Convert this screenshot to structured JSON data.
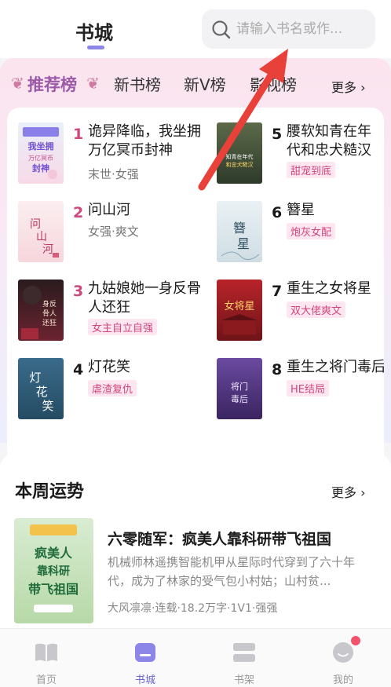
{
  "header": {
    "title": "书城"
  },
  "search": {
    "placeholder": "请输入书名或作..."
  },
  "rank_tabs": {
    "recommend": "推荐榜",
    "new_books": "新书榜",
    "new_v": "新V榜",
    "film": "影视榜",
    "more": "更多 ›"
  },
  "rank_books": [
    {
      "no": "1",
      "title": "诡异降临，我坐拥万亿冥币封神",
      "tag": "末世·女强"
    },
    {
      "no": "2",
      "title": "问山河",
      "tag": "女强·爽文"
    },
    {
      "no": "3",
      "title": "九姑娘她一身反骨人还狂",
      "tag": "女主自立自强"
    },
    {
      "no": "4",
      "title": "灯花笑",
      "tag": "虐渣复仇"
    },
    {
      "no": "5",
      "title": "腰软知青在年代和忠犬糙汉财",
      "tag": "甜宠到底"
    },
    {
      "no": "6",
      "title": "簪星",
      "tag": "炮灰女配"
    },
    {
      "no": "7",
      "title": "重生之女将星",
      "tag": "双大佬爽文"
    },
    {
      "no": "8",
      "title": "重生之将门毒后",
      "tag": "HE结局"
    }
  ],
  "covers": {
    "c1": "我坐拥万亿冥币封神",
    "c2": "问山河",
    "c3": "身反骨人还狂",
    "c4": "灯花笑",
    "c5": "知青在年代和忠犬糙汉",
    "c6": "簪星",
    "c7": "女将星",
    "c8": "将门毒后"
  },
  "week": {
    "title": "本周运势",
    "more": "更多 ›",
    "book_title": "六零随军：疯美人靠科研带飞祖国",
    "desc": "机械师林遥携智能机甲从星际时代穿到了六十年代，成为了林家的受气包小村姑；山村贫...",
    "meta": "大风凛凛·连载·18.2万字·1V1·强强",
    "cover_text": "疯美人靠科研带飞祖国"
  },
  "nav": [
    {
      "label": "首页"
    },
    {
      "label": "书城"
    },
    {
      "label": "书架"
    },
    {
      "label": "我的"
    }
  ],
  "colors": {
    "accent": "#6a63d8",
    "rank_pink": "#d0467f",
    "arrow_red": "#e8413a"
  }
}
